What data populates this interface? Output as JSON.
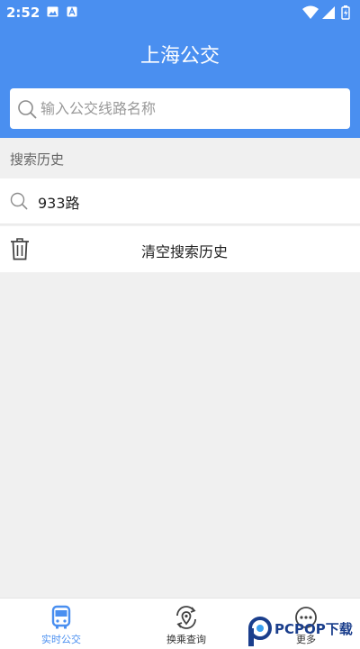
{
  "status_bar": {
    "time": "2:52"
  },
  "header": {
    "title": "上海公交"
  },
  "search": {
    "placeholder": "输入公交线路名称",
    "value": ""
  },
  "history": {
    "section_label": "搜索历史",
    "items": [
      {
        "label": "933路"
      }
    ],
    "clear_label": "清空搜索历史"
  },
  "tabbar": {
    "items": [
      {
        "label": "实时公交",
        "icon": "bus-icon",
        "active": true
      },
      {
        "label": "换乘查询",
        "icon": "transfer-location-icon",
        "active": false
      },
      {
        "label": "更多",
        "icon": "more-icon",
        "active": false
      }
    ]
  },
  "watermark": {
    "text": "PCPOP下载"
  },
  "colors": {
    "primary": "#4a8ff0",
    "background": "#f0f0f0",
    "text": "#222222",
    "muted": "#999999"
  }
}
